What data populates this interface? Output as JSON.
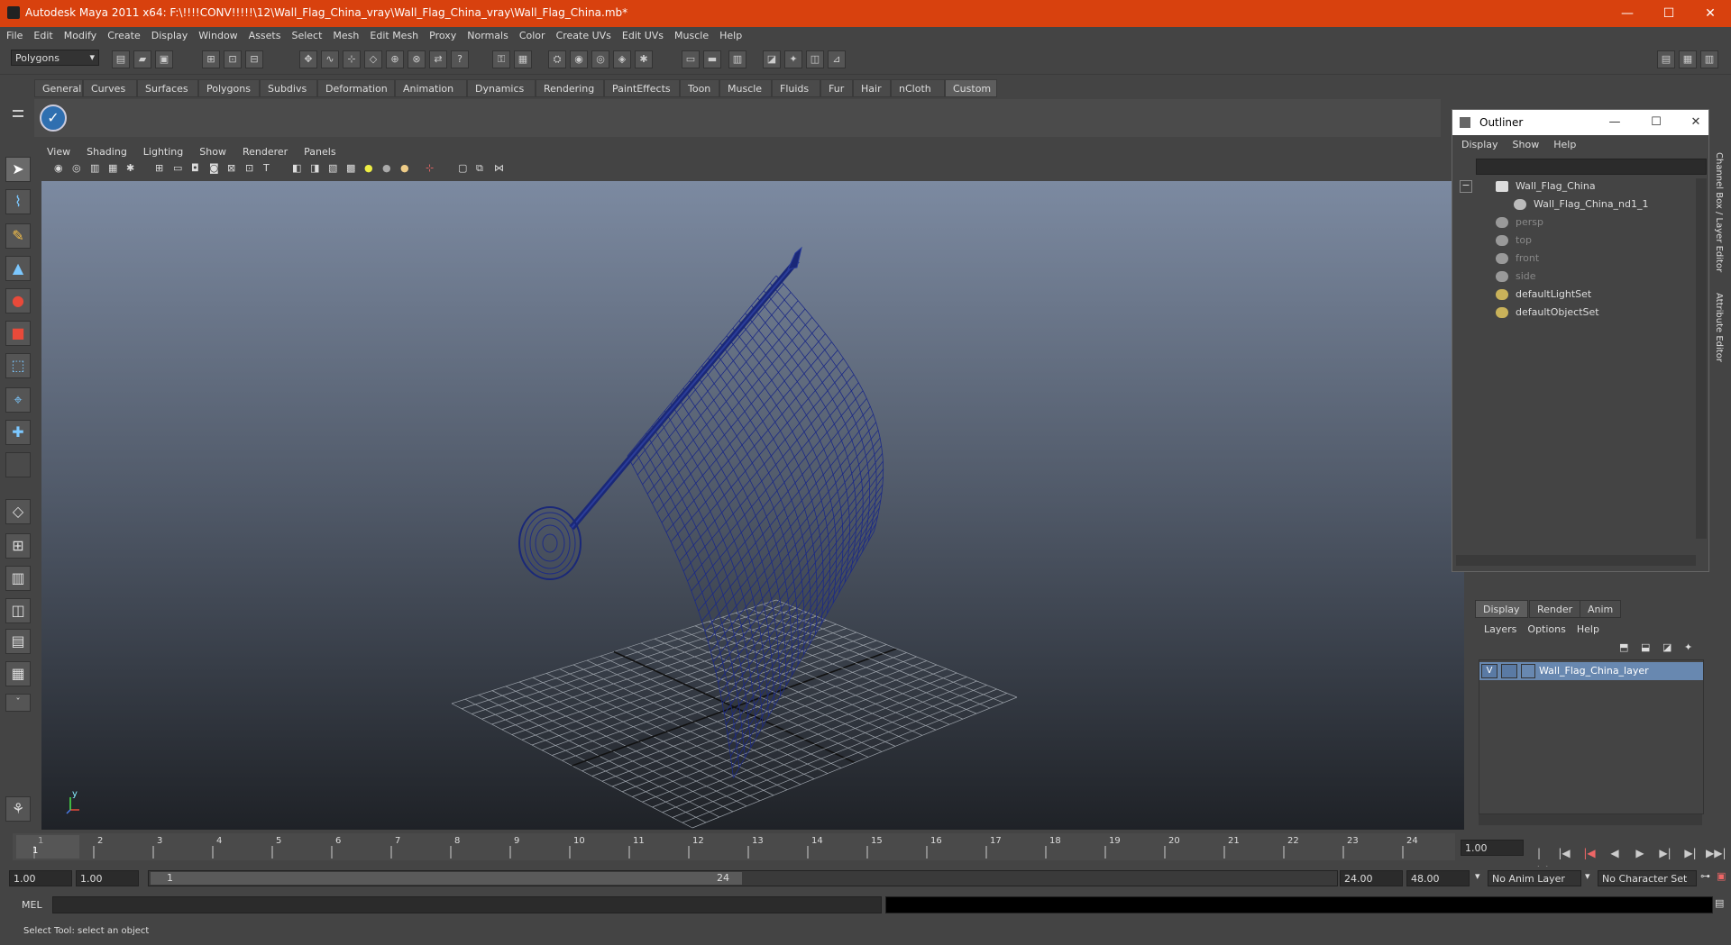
{
  "window": {
    "title": "Autodesk Maya 2011 x64: F:\\!!!!CONV!!!!!\\12\\Wall_Flag_China_vray\\Wall_Flag_China_vray\\Wall_Flag_China.mb*",
    "minimize": "—",
    "maximize": "☐",
    "close": "✕"
  },
  "menubar": [
    "File",
    "Edit",
    "Modify",
    "Create",
    "Display",
    "Window",
    "Assets",
    "Select",
    "Mesh",
    "Edit Mesh",
    "Proxy",
    "Normals",
    "Color",
    "Create UVs",
    "Edit UVs",
    "Muscle",
    "Help"
  ],
  "status": {
    "mode": "Polygons"
  },
  "shelf": {
    "tabs": [
      "General",
      "Curves",
      "Surfaces",
      "Polygons",
      "Subdivs",
      "Deformation",
      "Animation",
      "Dynamics",
      "Rendering",
      "PaintEffects",
      "Toon",
      "Muscle",
      "Fluids",
      "Fur",
      "Hair",
      "nCloth",
      "Custom"
    ],
    "active": "Custom"
  },
  "panel": {
    "menus": [
      "View",
      "Shading",
      "Lighting",
      "Show",
      "Renderer",
      "Panels"
    ]
  },
  "viewport": {
    "axis_y": "y",
    "axis_x": "x"
  },
  "outliner": {
    "title": "Outliner",
    "menus": [
      "Display",
      "Show",
      "Help"
    ],
    "items": [
      {
        "label": "Wall_Flag_China",
        "dim": false
      },
      {
        "label": "Wall_Flag_China_nd1_1",
        "dim": false
      },
      {
        "label": "persp",
        "dim": true
      },
      {
        "label": "top",
        "dim": true
      },
      {
        "label": "front",
        "dim": true
      },
      {
        "label": "side",
        "dim": true
      },
      {
        "label": "defaultLightSet",
        "dim": false
      },
      {
        "label": "defaultObjectSet",
        "dim": false
      }
    ]
  },
  "side_tabs": {
    "channel_box": "Channel Box / Layer Editor",
    "attribute_editor": "Attribute Editor"
  },
  "layer_editor": {
    "tabs": [
      "Display",
      "Render",
      "Anim"
    ],
    "active": "Display",
    "menus": [
      "Layers",
      "Options",
      "Help"
    ],
    "layer": {
      "visible": "V",
      "name": "Wall_Flag_China_layer"
    }
  },
  "timeline": {
    "ticks": [
      "1",
      "2",
      "3",
      "4",
      "5",
      "6",
      "7",
      "8",
      "9",
      "10",
      "11",
      "12",
      "13",
      "14",
      "15",
      "16",
      "17",
      "18",
      "19",
      "20",
      "21",
      "22",
      "23",
      "24"
    ],
    "current_frame_marker": "1",
    "current_time": "1.00"
  },
  "range": {
    "start_time": "1.00",
    "playback_start": "1.00",
    "slider_start": "1",
    "slider_end": "24",
    "playback_end": "24.00",
    "end_time": "48.00",
    "anim_layer": "No Anim Layer",
    "character_set": "No Character Set"
  },
  "command": {
    "label": "MEL"
  },
  "help": {
    "text": "Select Tool: select an object"
  }
}
